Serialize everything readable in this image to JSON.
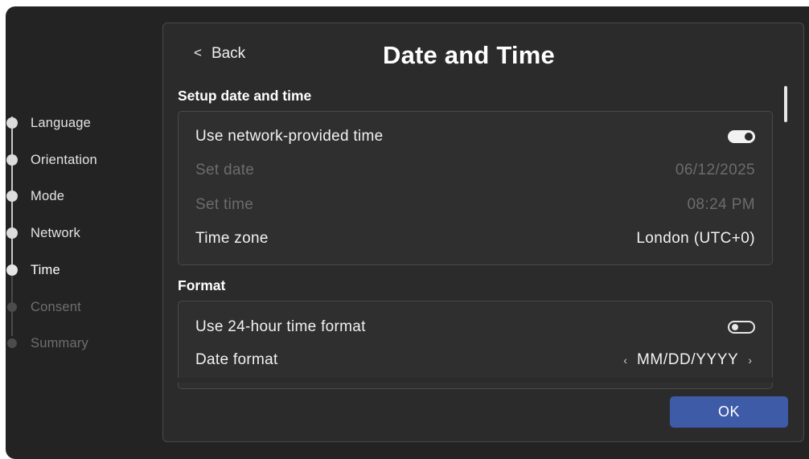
{
  "sidebar": {
    "steps": [
      {
        "label": "Language",
        "state": "done"
      },
      {
        "label": "Orientation",
        "state": "done"
      },
      {
        "label": "Mode",
        "state": "done"
      },
      {
        "label": "Network",
        "state": "done"
      },
      {
        "label": "Time",
        "state": "current"
      },
      {
        "label": "Consent",
        "state": "future"
      },
      {
        "label": "Summary",
        "state": "future"
      }
    ]
  },
  "header": {
    "back_icon": "chevron-left-icon",
    "back_label": "Back",
    "title": "Date and Time"
  },
  "setup_section": {
    "title": "Setup date and time",
    "network_time": {
      "label": "Use network-provided time",
      "enabled": true
    },
    "set_date": {
      "label": "Set date",
      "value": "06/12/2025"
    },
    "set_time": {
      "label": "Set time",
      "value": "08:24 PM"
    },
    "time_zone": {
      "label": "Time zone",
      "value": "London (UTC+0)"
    }
  },
  "format_section": {
    "title": "Format",
    "hour24": {
      "label": "Use 24-hour time format",
      "enabled": false
    },
    "date_format": {
      "label": "Date format",
      "value": "MM/DD/YYYY",
      "prev_glyph": "‹",
      "next_glyph": "›"
    }
  },
  "footer": {
    "ok_label": "OK"
  },
  "colors": {
    "background": "#232323",
    "panel": "#2b2b2b",
    "accent": "#3e5ba8",
    "disabled_text": "#6c6c6c"
  }
}
